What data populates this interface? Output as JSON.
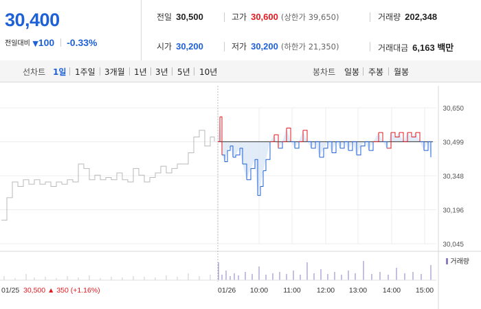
{
  "summary": {
    "current_price": "30,400",
    "change_label": "전일대비",
    "change_arrow": "▼",
    "change_amount": "100",
    "change_percent": "-0.33%"
  },
  "info": {
    "prev_close_label": "전일",
    "prev_close": "30,500",
    "high_label": "고가",
    "high": "30,600",
    "upper_limit": "(상한가 39,650)",
    "volume_label": "거래량",
    "volume": "202,348",
    "open_label": "시가",
    "open": "30,200",
    "low_label": "저가",
    "low": "30,200",
    "lower_limit": "(하한가 21,350)",
    "amount_label": "거래대금",
    "amount": "6,163 백만"
  },
  "line_chart_tabs": {
    "label": "선차트",
    "items": [
      "1일",
      "1주일",
      "3개월",
      "1년",
      "3년",
      "5년",
      "10년"
    ],
    "active": "1일"
  },
  "candle_chart_tabs": {
    "label": "봉차트",
    "items": [
      "일봉",
      "주봉",
      "월봉"
    ]
  },
  "colors": {
    "up": "#e0191f",
    "down": "#1e61d6",
    "prev_day": "#b9b9b9",
    "volume": "#8e7cc3",
    "fill": "#dbe7f6"
  },
  "chart_data": {
    "type": "line",
    "y_ticks": [
      "30,650",
      "30,499",
      "30,348",
      "30,196",
      "30,045"
    ],
    "ylim": [
      30045,
      30650
    ],
    "reference_price": 30499,
    "x_tick_labels": [
      "01/26",
      "10:00",
      "11:00",
      "12:00",
      "13:00",
      "14:00",
      "15:00"
    ],
    "prev_day": {
      "date": "01/25",
      "close": "30,500",
      "change_arrow": "▲",
      "change": "350",
      "change_percent": "(+1.16%)"
    },
    "prev_day_series": [
      [
        0,
        30150
      ],
      [
        8,
        30250
      ],
      [
        16,
        30320
      ],
      [
        24,
        30300
      ],
      [
        32,
        30330
      ],
      [
        40,
        30310
      ],
      [
        48,
        30330
      ],
      [
        56,
        30310
      ],
      [
        64,
        30320
      ],
      [
        72,
        30300
      ],
      [
        80,
        30320
      ],
      [
        88,
        30310
      ],
      [
        96,
        30330
      ],
      [
        104,
        30320
      ],
      [
        112,
        30400
      ],
      [
        120,
        30380
      ],
      [
        128,
        30330
      ],
      [
        136,
        30350
      ],
      [
        144,
        30330
      ],
      [
        152,
        30340
      ],
      [
        160,
        30330
      ],
      [
        168,
        30360
      ],
      [
        176,
        30330
      ],
      [
        184,
        30320
      ],
      [
        192,
        30380
      ],
      [
        200,
        30350
      ],
      [
        208,
        30320
      ],
      [
        216,
        30340
      ],
      [
        224,
        30360
      ],
      [
        232,
        30390
      ],
      [
        240,
        30360
      ],
      [
        248,
        30380
      ],
      [
        256,
        30400
      ],
      [
        264,
        30400
      ],
      [
        272,
        30450
      ],
      [
        280,
        30520
      ],
      [
        288,
        30550
      ],
      [
        296,
        30480
      ],
      [
        304,
        30520
      ],
      [
        310,
        30500
      ]
    ],
    "today_series": [
      [
        0,
        30499
      ],
      [
        3,
        30610
      ],
      [
        6,
        30440
      ],
      [
        10,
        30410
      ],
      [
        14,
        30460
      ],
      [
        18,
        30480
      ],
      [
        22,
        30430
      ],
      [
        26,
        30440
      ],
      [
        32,
        30470
      ],
      [
        36,
        30400
      ],
      [
        42,
        30330
      ],
      [
        48,
        30380
      ],
      [
        54,
        30420
      ],
      [
        58,
        30260
      ],
      [
        62,
        30300
      ],
      [
        66,
        30370
      ],
      [
        70,
        30420
      ],
      [
        76,
        30499
      ],
      [
        82,
        30530
      ],
      [
        88,
        30470
      ],
      [
        94,
        30499
      ],
      [
        100,
        30560
      ],
      [
        106,
        30499
      ],
      [
        112,
        30470
      ],
      [
        118,
        30499
      ],
      [
        124,
        30550
      ],
      [
        130,
        30499
      ],
      [
        136,
        30470
      ],
      [
        142,
        30499
      ],
      [
        148,
        30430
      ],
      [
        154,
        30470
      ],
      [
        160,
        30499
      ],
      [
        166,
        30450
      ],
      [
        172,
        30499
      ],
      [
        178,
        30470
      ],
      [
        184,
        30499
      ],
      [
        190,
        30460
      ],
      [
        196,
        30499
      ],
      [
        202,
        30440
      ],
      [
        208,
        30480
      ],
      [
        214,
        30499
      ],
      [
        220,
        30460
      ],
      [
        226,
        30499
      ],
      [
        234,
        30540
      ],
      [
        240,
        30499
      ],
      [
        246,
        30470
      ],
      [
        252,
        30540
      ],
      [
        258,
        30520
      ],
      [
        264,
        30540
      ],
      [
        270,
        30499
      ],
      [
        276,
        30540
      ],
      [
        282,
        30520
      ],
      [
        288,
        30540
      ],
      [
        294,
        30499
      ],
      [
        300,
        30460
      ],
      [
        306,
        30499
      ],
      [
        310,
        30430
      ]
    ],
    "volume_series_prev": [
      [
        4,
        6
      ],
      [
        20,
        3
      ],
      [
        36,
        9
      ],
      [
        48,
        4
      ],
      [
        64,
        5
      ],
      [
        80,
        3
      ],
      [
        96,
        6
      ],
      [
        112,
        4
      ],
      [
        128,
        7
      ],
      [
        144,
        3
      ],
      [
        160,
        5
      ],
      [
        176,
        4
      ],
      [
        192,
        6
      ],
      [
        208,
        5
      ],
      [
        224,
        4
      ],
      [
        240,
        7
      ],
      [
        256,
        5
      ],
      [
        272,
        10
      ],
      [
        288,
        6
      ],
      [
        304,
        8
      ]
    ],
    "volume_series_today": [
      [
        1,
        26
      ],
      [
        6,
        8
      ],
      [
        12,
        14
      ],
      [
        18,
        6
      ],
      [
        24,
        10
      ],
      [
        30,
        7
      ],
      [
        40,
        12
      ],
      [
        50,
        9
      ],
      [
        60,
        20
      ],
      [
        70,
        8
      ],
      [
        80,
        10
      ],
      [
        90,
        12
      ],
      [
        100,
        9
      ],
      [
        110,
        14
      ],
      [
        120,
        8
      ],
      [
        130,
        26
      ],
      [
        140,
        10
      ],
      [
        150,
        16
      ],
      [
        160,
        9
      ],
      [
        170,
        12
      ],
      [
        180,
        8
      ],
      [
        190,
        14
      ],
      [
        200,
        10
      ],
      [
        212,
        28
      ],
      [
        224,
        9
      ],
      [
        236,
        12
      ],
      [
        248,
        8
      ],
      [
        260,
        18
      ],
      [
        272,
        10
      ],
      [
        284,
        12
      ],
      [
        296,
        9
      ],
      [
        310,
        22
      ]
    ],
    "legend": "거래량"
  }
}
